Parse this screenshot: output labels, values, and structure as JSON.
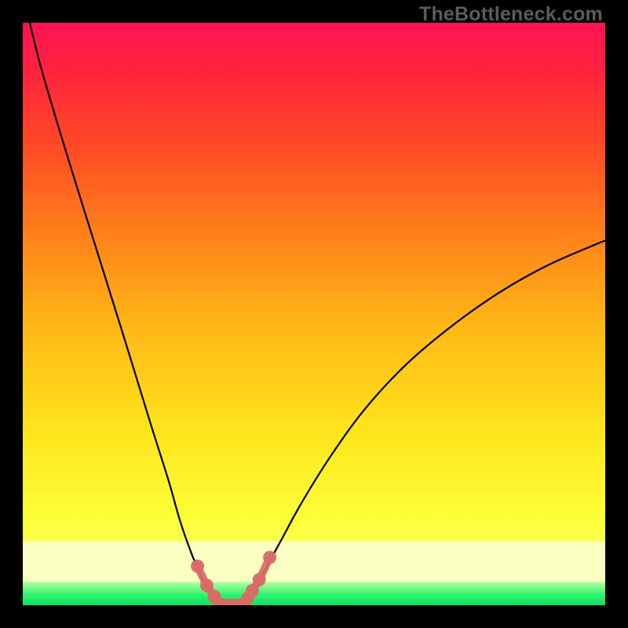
{
  "watermark": "TheBottleneck.com",
  "chart_data": {
    "type": "line",
    "title": "",
    "xlabel": "",
    "ylabel": "",
    "xlim": [
      0,
      100
    ],
    "ylim": [
      0,
      100
    ],
    "left_curve": {
      "x": [
        1.2,
        3.5,
        8,
        13,
        18,
        22,
        25,
        27,
        29,
        30.5,
        31.8,
        33,
        33.8
      ],
      "y": [
        100,
        91,
        76,
        60,
        44,
        31,
        21.5,
        14.5,
        8.8,
        5.3,
        2.8,
        1.2,
        0.2
      ]
    },
    "right_curve": {
      "x": [
        37.8,
        39,
        41,
        44,
        48,
        53,
        59,
        66,
        74,
        82,
        90,
        98,
        100
      ],
      "y": [
        0.2,
        1.6,
        5.0,
        10.5,
        17.8,
        25.8,
        34.0,
        41.5,
        48.2,
        53.8,
        58.3,
        61.8,
        62.6
      ]
    },
    "markers": {
      "x": [
        30.0,
        31.6,
        32.9,
        33.8,
        34.8,
        35.8,
        36.8,
        37.8,
        38.6,
        39.4,
        40.6,
        42.4
      ],
      "y": [
        6.7,
        3.4,
        1.5,
        0.2,
        -0.3,
        -0.5,
        -0.3,
        0.2,
        1.2,
        2.5,
        4.4,
        8.2
      ]
    },
    "green_band": {
      "y_start": 0,
      "y_end": 4.0
    },
    "pale_band": {
      "y_start": 4.0,
      "y_end": 11.0
    },
    "background_gradient": {
      "stops": [
        {
          "offset": 0.0,
          "color": "#ff1353"
        },
        {
          "offset": 0.08,
          "color": "#ff223f"
        },
        {
          "offset": 0.2,
          "color": "#ff4627"
        },
        {
          "offset": 0.35,
          "color": "#ff7c1a"
        },
        {
          "offset": 0.52,
          "color": "#ffb716"
        },
        {
          "offset": 0.7,
          "color": "#ffe41c"
        },
        {
          "offset": 0.85,
          "color": "#fcff38"
        },
        {
          "offset": 1.0,
          "color": "#f1ff7a"
        }
      ]
    }
  }
}
